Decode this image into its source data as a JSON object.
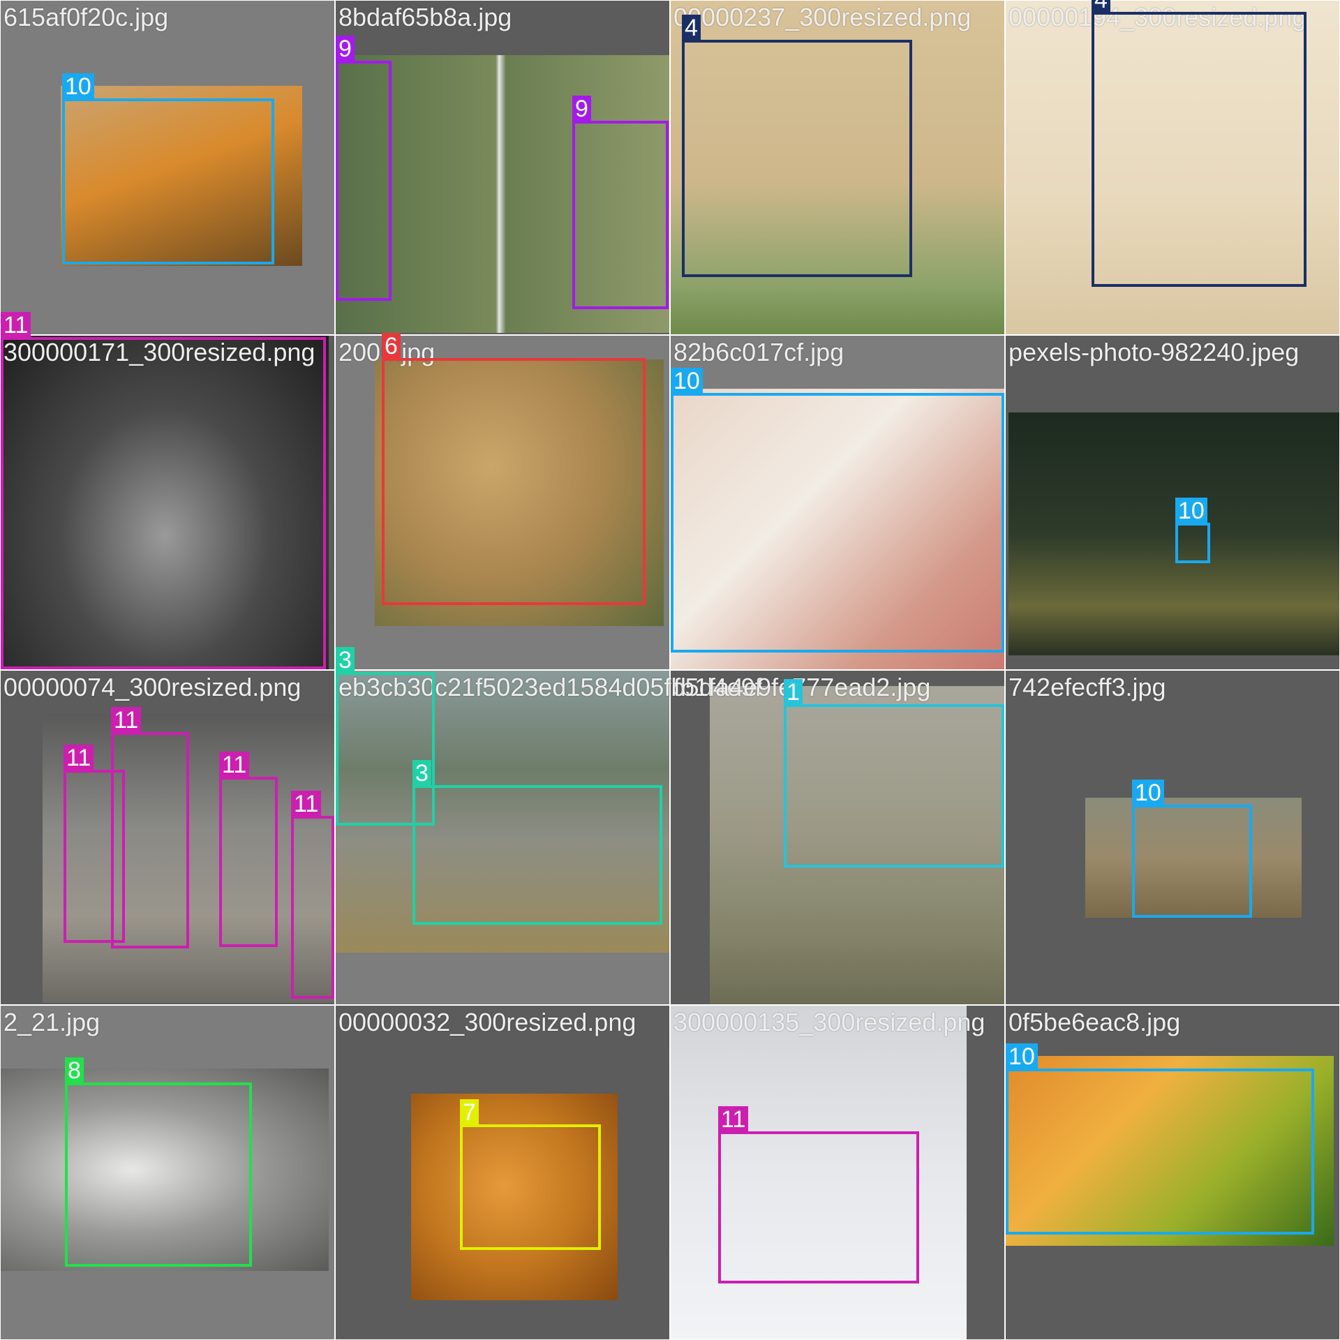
{
  "colors": {
    "class_1": "#26c4d9",
    "class_3": "#1fd1a7",
    "class_4": "#1a2f66",
    "class_6": "#e8383b",
    "class_7": "#e0f000",
    "class_8": "#22e04a",
    "class_9": "#a31aeb",
    "class_10": "#19a9f0",
    "class_11": "#cc1fb0",
    "tile_light": "#7d7d7d",
    "tile_dark": "#5c5c5c"
  },
  "tiles": [
    {
      "filename": "615af0f20c.jpg",
      "labels": [
        "10"
      ]
    },
    {
      "filename": "8bdaf65b8a.jpg",
      "labels": [
        "9",
        "9"
      ]
    },
    {
      "filename": "00000237_300resized.png",
      "labels": [
        "4"
      ]
    },
    {
      "filename": "00000194_300resized.png",
      "labels": [
        "4"
      ]
    },
    {
      "filename": "300000171_300resized.png",
      "labels": [
        "11"
      ]
    },
    {
      "filename": "2006.jpg",
      "labels": [
        "6"
      ]
    },
    {
      "filename": "82b6c017cf.jpg",
      "labels": [
        "10"
      ]
    },
    {
      "filename": "pexels-photo-982240.jpeg",
      "labels": [
        "10"
      ]
    },
    {
      "filename": "00000074_300resized.png",
      "labels": [
        "11",
        "11",
        "11",
        "11"
      ]
    },
    {
      "filename": "eb3cb30c21f5023ed1584d05fb5d4e9f",
      "labels": [
        "3",
        "3"
      ]
    },
    {
      "filename": "fb1fa4e9fe777ead2.jpg",
      "labels": [
        "1"
      ]
    },
    {
      "filename": "742efecff3.jpg",
      "labels": [
        "10"
      ]
    },
    {
      "filename": "2_21.jpg",
      "labels": [
        "8"
      ]
    },
    {
      "filename": "00000032_300resized.png",
      "labels": [
        "7"
      ]
    },
    {
      "filename": "300000135_300resized.png",
      "labels": [
        "11"
      ]
    },
    {
      "filename": "0f5be6eac8.jpg",
      "labels": [
        "10"
      ]
    }
  ]
}
